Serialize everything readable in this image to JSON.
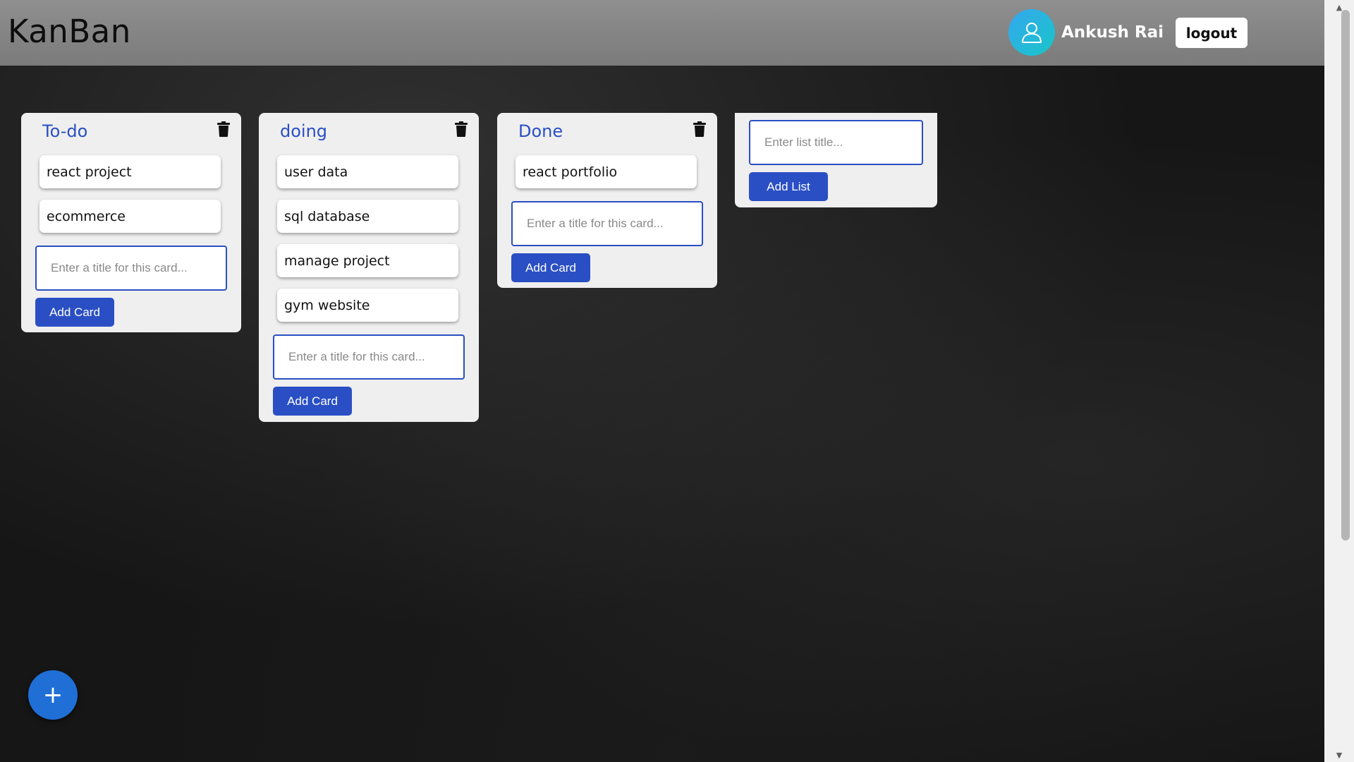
{
  "header": {
    "brand": "KanBan",
    "user_name": "Ankush Rai",
    "logout_label": "logout"
  },
  "lists": [
    {
      "title": "To-do",
      "cards": [
        "react project",
        "ecommerce"
      ],
      "card_input_placeholder": "Enter a title for this card...",
      "add_card_label": "Add Card"
    },
    {
      "title": "doing",
      "cards": [
        "user data",
        "sql database",
        "manage project",
        "gym website"
      ],
      "card_input_placeholder": "Enter a title for this card...",
      "add_card_label": "Add Card"
    },
    {
      "title": "Done",
      "cards": [
        "react portfolio"
      ],
      "card_input_placeholder": "Enter a title for this card...",
      "add_card_label": "Add Card"
    }
  ],
  "new_list": {
    "title_placeholder": "Enter list title...",
    "add_list_label": "Add List"
  },
  "fab": {
    "icon": "plus-icon",
    "label": "+"
  },
  "colors": {
    "accent": "#2a4fc4",
    "header_bg": "#8a8a8a",
    "list_bg": "#efefef",
    "fab": "#1f6fd6",
    "avatar_gradient_start": "#35a7ee",
    "avatar_gradient_end": "#18c6c8"
  }
}
